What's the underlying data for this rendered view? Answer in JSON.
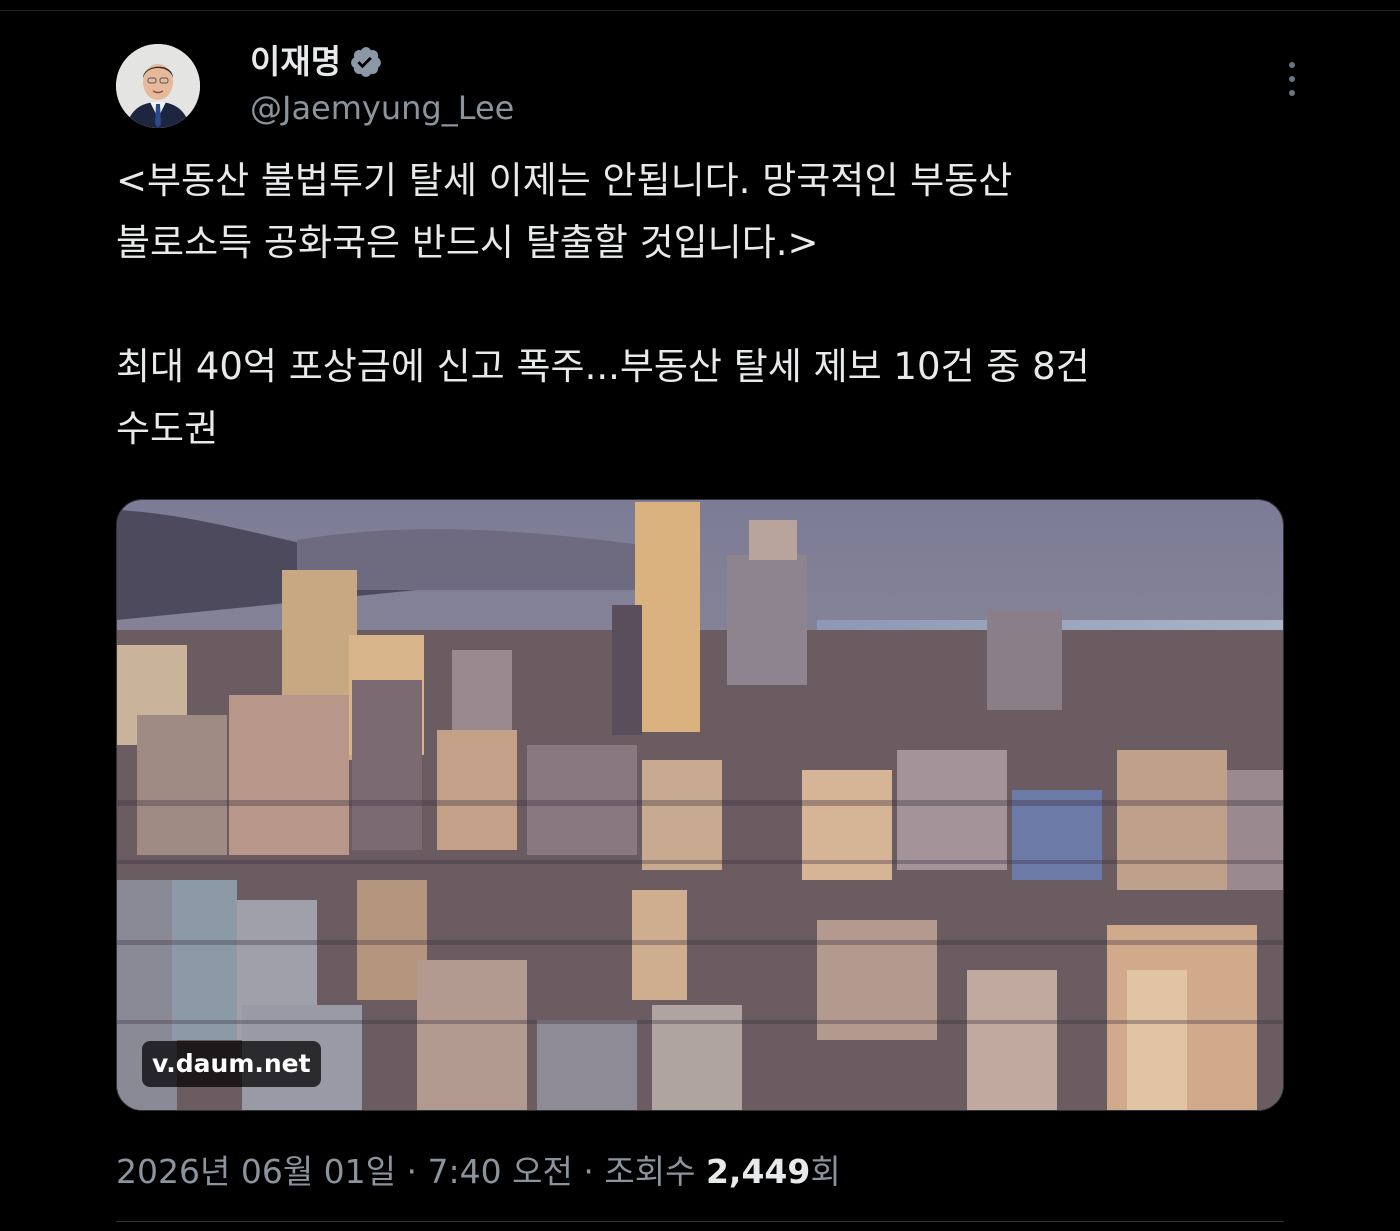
{
  "author": {
    "display_name": "이재명",
    "handle": "@Jaemyung_Lee",
    "verified_icon": "verified-badge-icon",
    "verified_color": "#8b98a5"
  },
  "tweet": {
    "line1": "<부동산 불법투기 탈세 이제는 안됩니다. 망국적인 부동산",
    "line2": "불로소득 공화국은 반드시 탈출할 것입니다.>",
    "line3": "최대 40억 포상금에 신고 폭주...부동산 탈세 제보 10건 중 8건",
    "line4": "수도권"
  },
  "link_card": {
    "domain": "v.daum.net",
    "image": "city-skyline-photo"
  },
  "meta": {
    "date": "2026년 06월 01일",
    "separator": "·",
    "time": "7:40 오전",
    "views_label": "조회수",
    "views_count": "2,449",
    "views_suffix": "회"
  },
  "icons": {
    "more": "more-options-icon"
  },
  "colors": {
    "background": "#000000",
    "text": "#e7e9ea",
    "secondary_text": "#8b949c"
  }
}
